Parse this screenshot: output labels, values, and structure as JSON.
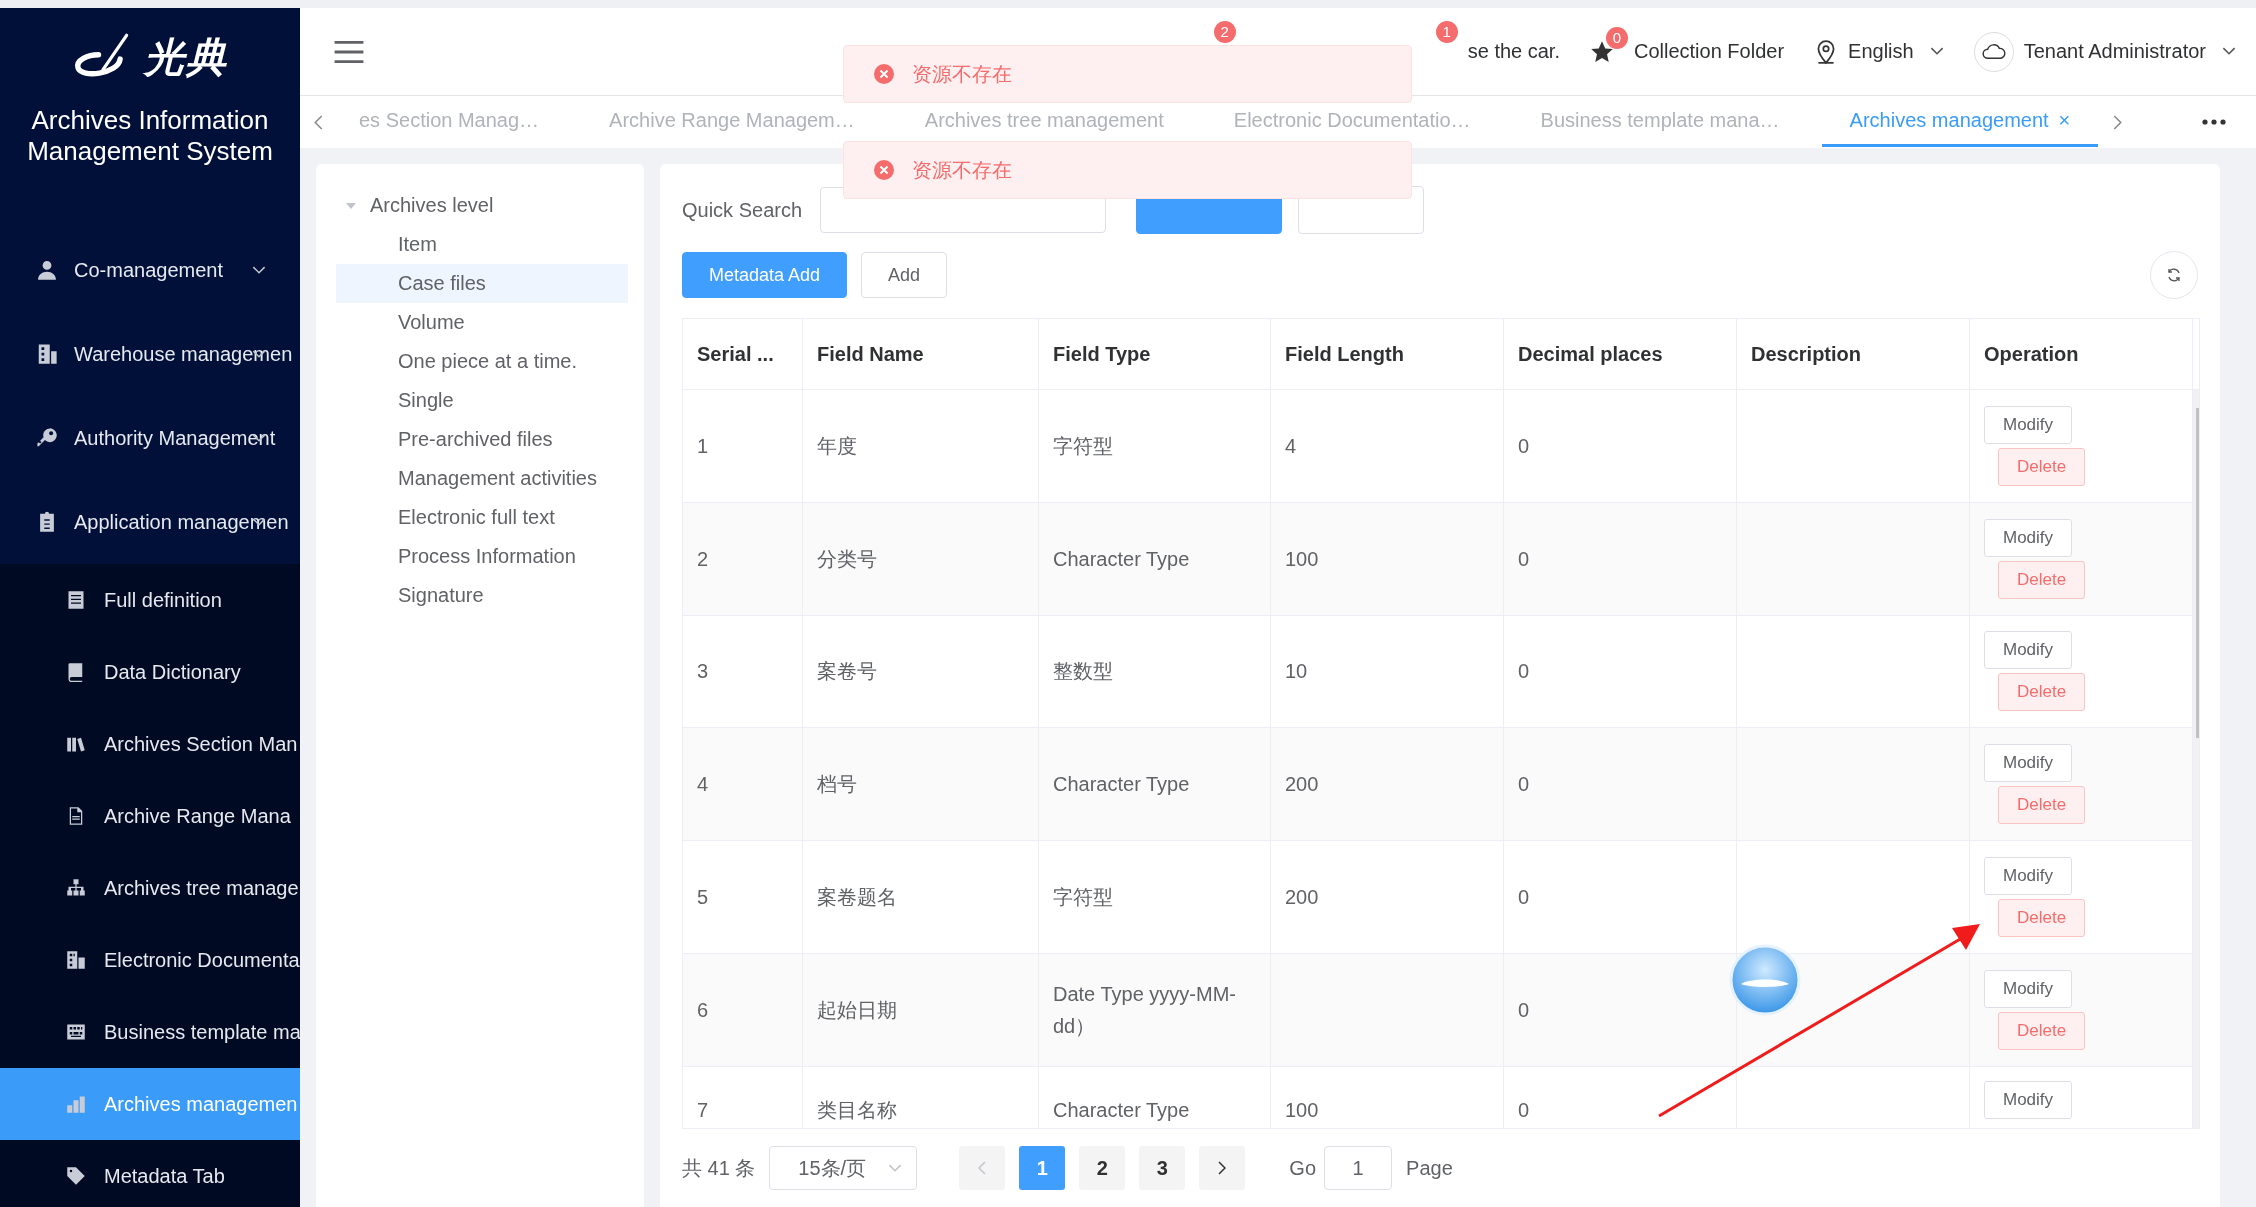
{
  "sidebar": {
    "logo_text": "光典",
    "title": "Archives Information Management System",
    "menu": [
      {
        "label": "Co-management"
      },
      {
        "label": "Warehouse managemen"
      },
      {
        "label": "Authority Management"
      },
      {
        "label": "Application managemen",
        "children": [
          {
            "label": "Full definition",
            "selected": false
          },
          {
            "label": "Data Dictionary",
            "selected": false
          },
          {
            "label": "Archives Section Man",
            "selected": false
          },
          {
            "label": "Archive Range Mana",
            "selected": false
          },
          {
            "label": "Archives tree manage",
            "selected": false
          },
          {
            "label": "Electronic Documenta",
            "selected": false
          },
          {
            "label": "Business template ma",
            "selected": false
          },
          {
            "label": "Archives managemen",
            "selected": true
          },
          {
            "label": "Metadata Tab",
            "selected": false
          }
        ]
      }
    ]
  },
  "header": {
    "badges": [
      "2",
      "1"
    ],
    "partial_text": "se the car.",
    "collection": {
      "badge": "0",
      "label": "Collection Folder"
    },
    "language": "English",
    "user": "Tenant Administrator"
  },
  "tabs": [
    {
      "label": "es Section Manag…",
      "selected": false
    },
    {
      "label": "Archive Range Managem…",
      "selected": false
    },
    {
      "label": "Archives tree management",
      "selected": false
    },
    {
      "label": "Electronic Documentatio…",
      "selected": false
    },
    {
      "label": "Business template mana…",
      "selected": false
    },
    {
      "label": "Archives management",
      "selected": true,
      "close": "×"
    }
  ],
  "toasts": [
    {
      "message": "资源不存在"
    },
    {
      "message": "资源不存在"
    }
  ],
  "tree": {
    "label": "Archives level",
    "expanded": true,
    "children": [
      {
        "label": "Item",
        "selected": false
      },
      {
        "label": "Case files",
        "selected": true
      },
      {
        "label": "Volume",
        "selected": false
      },
      {
        "label": "One piece at a time.",
        "selected": false
      },
      {
        "label": "Single",
        "selected": false
      },
      {
        "label": "Pre-archived files",
        "selected": false
      },
      {
        "label": "Management activities",
        "selected": false
      },
      {
        "label": "Electronic full text",
        "selected": false
      },
      {
        "label": "Process Information",
        "selected": false
      },
      {
        "label": "Signature",
        "selected": false
      }
    ]
  },
  "toolbar": {
    "search_label": "Quick Search",
    "buttons": [
      {
        "label": "Metadata Add",
        "kind": "primary"
      },
      {
        "label": "Add",
        "kind": "default"
      }
    ]
  },
  "table": {
    "columns": [
      "Serial ...",
      "Field Name",
      "Field Type",
      "Field Length",
      "Decimal places",
      "Description",
      "Operation"
    ],
    "rows": [
      {
        "cells": [
          "1",
          "年度",
          "字符型",
          "4",
          "0",
          ""
        ],
        "actions": [
          {
            "label": "Modify",
            "kind": "modify"
          },
          {
            "label": "Delete",
            "kind": "delete"
          }
        ]
      },
      {
        "cells": [
          "2",
          "分类号",
          "Character Type",
          "100",
          "0",
          ""
        ],
        "actions": [
          {
            "label": "Modify",
            "kind": "modify"
          },
          {
            "label": "Delete",
            "kind": "delete"
          }
        ]
      },
      {
        "cells": [
          "3",
          "案卷号",
          "整数型",
          "10",
          "0",
          ""
        ],
        "actions": [
          {
            "label": "Modify",
            "kind": "modify"
          },
          {
            "label": "Delete",
            "kind": "delete"
          }
        ]
      },
      {
        "cells": [
          "4",
          "档号",
          "Character Type",
          "200",
          "0",
          ""
        ],
        "actions": [
          {
            "label": "Modify",
            "kind": "modify"
          },
          {
            "label": "Delete",
            "kind": "delete"
          }
        ]
      },
      {
        "cells": [
          "5",
          "案卷题名",
          "字符型",
          "200",
          "0",
          ""
        ],
        "actions": [
          {
            "label": "Modify",
            "kind": "modify"
          },
          {
            "label": "Delete",
            "kind": "delete"
          }
        ]
      },
      {
        "cells": [
          "6",
          "起始日期",
          "Date Type yyyy-MM-dd）",
          "",
          "0",
          ""
        ],
        "actions": [
          {
            "label": "Modify",
            "kind": "modify"
          },
          {
            "label": "Delete",
            "kind": "delete"
          }
        ]
      },
      {
        "cells": [
          "7",
          "类目名称",
          "Character Type",
          "100",
          "0",
          ""
        ],
        "actions": [
          {
            "label": "Modify",
            "kind": "modify"
          }
        ]
      }
    ]
  },
  "pagination": {
    "total": "共 41 条",
    "page_size": "15条/页",
    "pages": [
      {
        "label": "1",
        "selected": true
      },
      {
        "label": "2",
        "selected": false
      },
      {
        "label": "3",
        "selected": false
      }
    ],
    "go_label": "Go",
    "go_value": "1",
    "page_label": "Page"
  }
}
